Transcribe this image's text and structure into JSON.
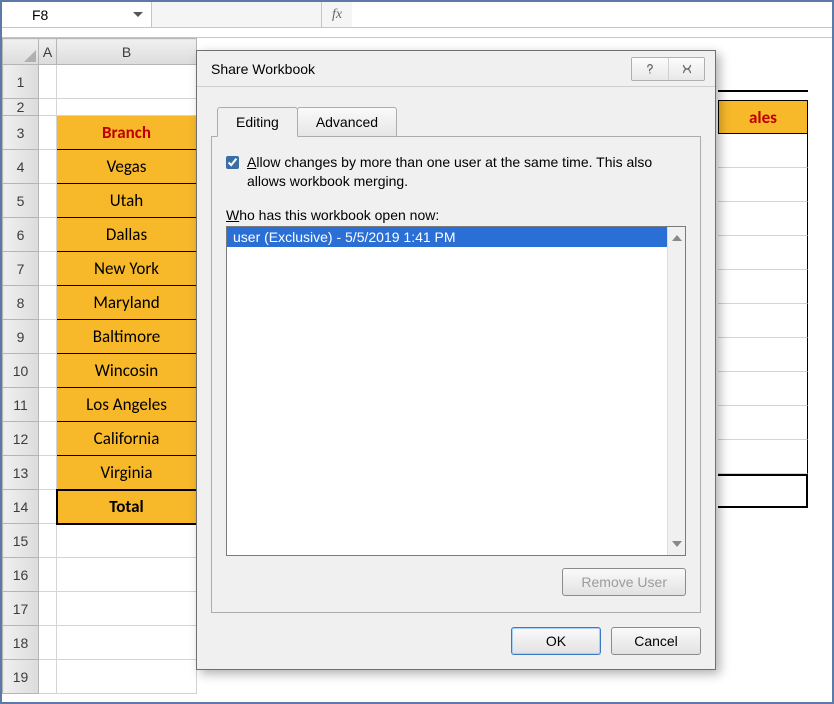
{
  "formula_bar": {
    "name_box": "F8",
    "fx_label": "fx",
    "value": ""
  },
  "columns": {
    "a": "A",
    "b": "B"
  },
  "rows": [
    "1",
    "2",
    "3",
    "4",
    "5",
    "6",
    "7",
    "8",
    "9",
    "10",
    "11",
    "12",
    "13",
    "14",
    "15",
    "16",
    "17",
    "18",
    "19"
  ],
  "sheet": {
    "b3_header": "Branch",
    "b4": "Vegas",
    "b5": "Utah",
    "b6": "Dallas",
    "b7": "New York",
    "b8": "Maryland",
    "b9": "Baltimore",
    "b10": "Wincosin",
    "b11": "Los Angeles",
    "b12": "California",
    "b13": "Virginia",
    "b14": "Total",
    "right_header_partial": "ales"
  },
  "dialog": {
    "title": "Share Workbook",
    "tabs": {
      "editing": "Editing",
      "advanced": "Advanced"
    },
    "checkbox_text": "Allow changes by more than one user at the same time.  This also allows workbook merging.",
    "checkbox_accel_prefix": "A",
    "who_label": "Who has this workbook open now:",
    "who_accel_prefix": "W",
    "user_entry": "user (Exclusive) - 5/5/2019 1:41 PM",
    "buttons": {
      "remove_user": "Remove User",
      "ok": "OK",
      "cancel": "Cancel"
    }
  }
}
